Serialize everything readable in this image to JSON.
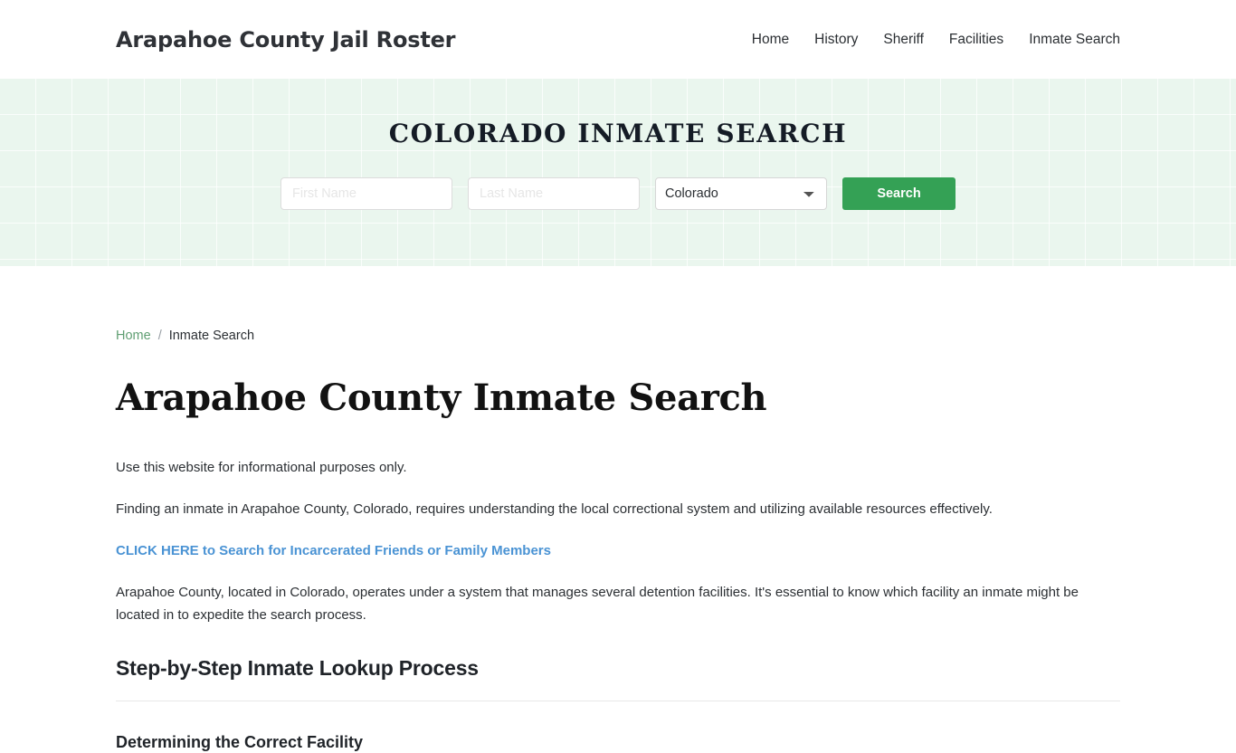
{
  "header": {
    "brand": "Arapahoe County Jail Roster",
    "nav": [
      {
        "label": "Home"
      },
      {
        "label": "History"
      },
      {
        "label": "Sheriff"
      },
      {
        "label": "Facilities"
      },
      {
        "label": "Inmate Search"
      }
    ]
  },
  "hero": {
    "title": "COLORADO INMATE SEARCH",
    "background_color": "#eaf6ee",
    "form": {
      "first_name": {
        "value": "",
        "placeholder": "First Name"
      },
      "last_name": {
        "value": "",
        "placeholder": "Last Name"
      },
      "state": {
        "selected": "Colorado",
        "options": [
          "Colorado"
        ]
      },
      "search_button": "Search",
      "button_color": "#34a155"
    }
  },
  "breadcrumb": {
    "home": "Home",
    "separator": "/",
    "current": "Inmate Search",
    "link_color": "#5f9e72"
  },
  "main": {
    "page_title": "Arapahoe County Inmate Search",
    "paragraph_1": "Use this website for informational purposes only.",
    "paragraph_2": "Finding an inmate in Arapahoe County, Colorado, requires understanding the local correctional system and utilizing available resources effectively.",
    "cta_link": "CLICK HERE to Search for Incarcerated Friends or Family Members",
    "cta_link_color": "#4a93d4",
    "paragraph_3": "Arapahoe County, located in Colorado, operates under a system that manages several detention facilities. It's essential to know which facility an inmate might be located in to expedite the search process.",
    "section_heading": "Step-by-Step Inmate Lookup Process",
    "sub_heading": "Determining the Correct Facility"
  }
}
